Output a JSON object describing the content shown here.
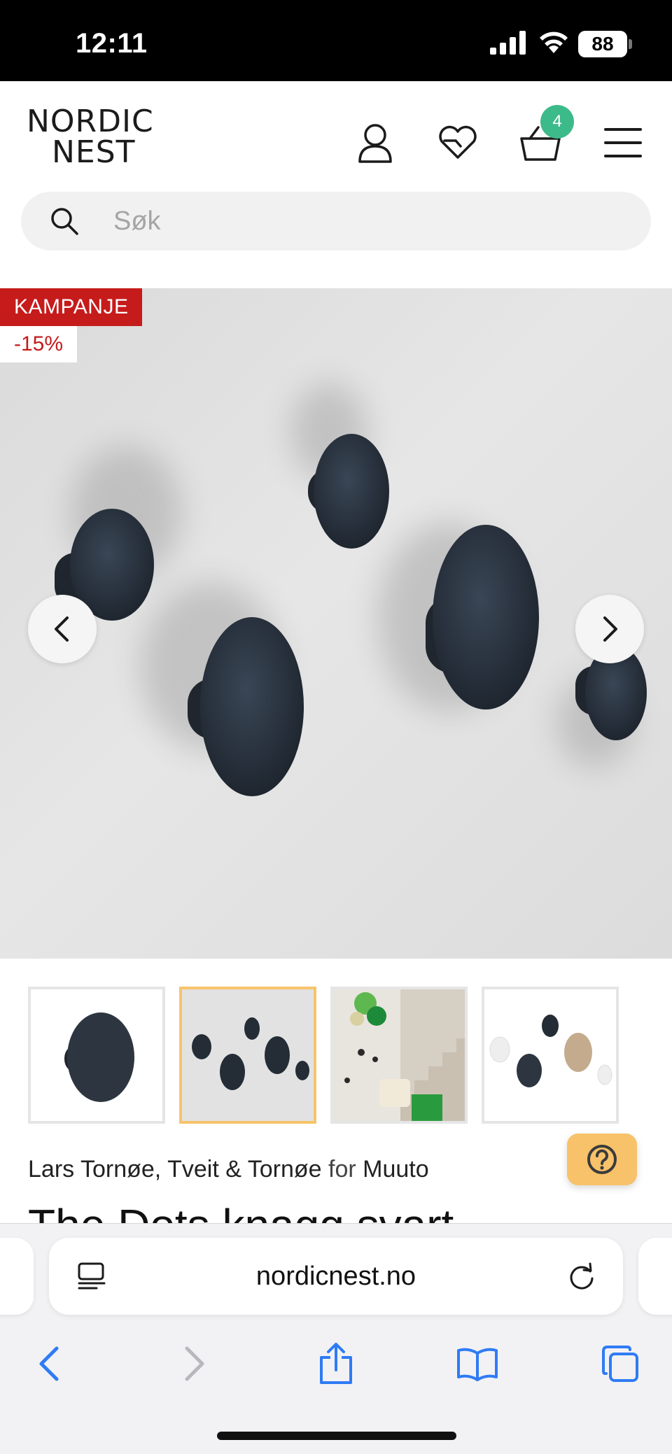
{
  "status_bar": {
    "time": "12:11",
    "battery": "88"
  },
  "header": {
    "logo_line1": "NORDIC",
    "logo_line2": "NEST",
    "cart_count": "4",
    "icons": [
      "user-icon",
      "heart-icon",
      "cart-icon",
      "menu-icon"
    ]
  },
  "search": {
    "placeholder": "Søk",
    "value": ""
  },
  "gallery": {
    "campaign_label": "KAMPANJE",
    "discount_label": "-15%",
    "active_index": 1
  },
  "thumbnails": [
    {
      "label": "single dot"
    },
    {
      "label": "dots on wall"
    },
    {
      "label": "staircase interior"
    },
    {
      "label": "dots mixed colors"
    }
  ],
  "product": {
    "designer_1": "Lars Tornøe",
    "separator": ",",
    "designer_2": "Tveit & Tornøe",
    "for_word": "for",
    "brand": "Muuto",
    "title": "The Dots knagg svart"
  },
  "browser": {
    "url": "nordicnest.no"
  },
  "colors": {
    "accent_green": "#3dba8a",
    "campaign_red": "#c61b1b",
    "help_yellow": "#f8c26a",
    "active_thumb_border": "#f6c46b"
  }
}
